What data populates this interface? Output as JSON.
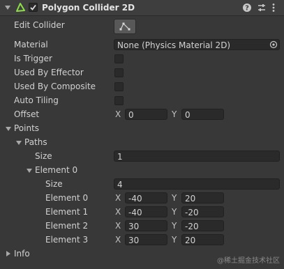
{
  "header": {
    "title": "Polygon Collider 2D",
    "enabled": true,
    "icons": [
      "polygon-collider-icon",
      "help-icon",
      "presets-icon",
      "more-icon"
    ]
  },
  "edit_collider": {
    "label": "Edit Collider"
  },
  "material": {
    "label": "Material",
    "value": "None (Physics Material 2D)"
  },
  "is_trigger": {
    "label": "Is Trigger",
    "checked": false
  },
  "used_by_effector": {
    "label": "Used By Effector",
    "checked": false
  },
  "used_by_composite": {
    "label": "Used By Composite",
    "checked": false
  },
  "auto_tiling": {
    "label": "Auto Tiling",
    "checked": false
  },
  "offset": {
    "label": "Offset",
    "x_label": "X",
    "x": "0",
    "y_label": "Y",
    "y": "0"
  },
  "points": {
    "label": "Points",
    "paths": {
      "label": "Paths",
      "size_label": "Size",
      "size": "1",
      "element0": {
        "label": "Element 0",
        "size_label": "Size",
        "size": "4",
        "rows": [
          {
            "label": "Element 0",
            "x_label": "X",
            "x": "-40",
            "y_label": "Y",
            "y": "20"
          },
          {
            "label": "Element 1",
            "x_label": "X",
            "x": "-40",
            "y_label": "Y",
            "y": "-20"
          },
          {
            "label": "Element 2",
            "x_label": "X",
            "x": "30",
            "y_label": "Y",
            "y": "-20"
          },
          {
            "label": "Element 3",
            "x_label": "X",
            "x": "30",
            "y_label": "Y",
            "y": "20"
          }
        ]
      }
    }
  },
  "info": {
    "label": "Info"
  },
  "watermark": "@稀土掘金技术社区"
}
